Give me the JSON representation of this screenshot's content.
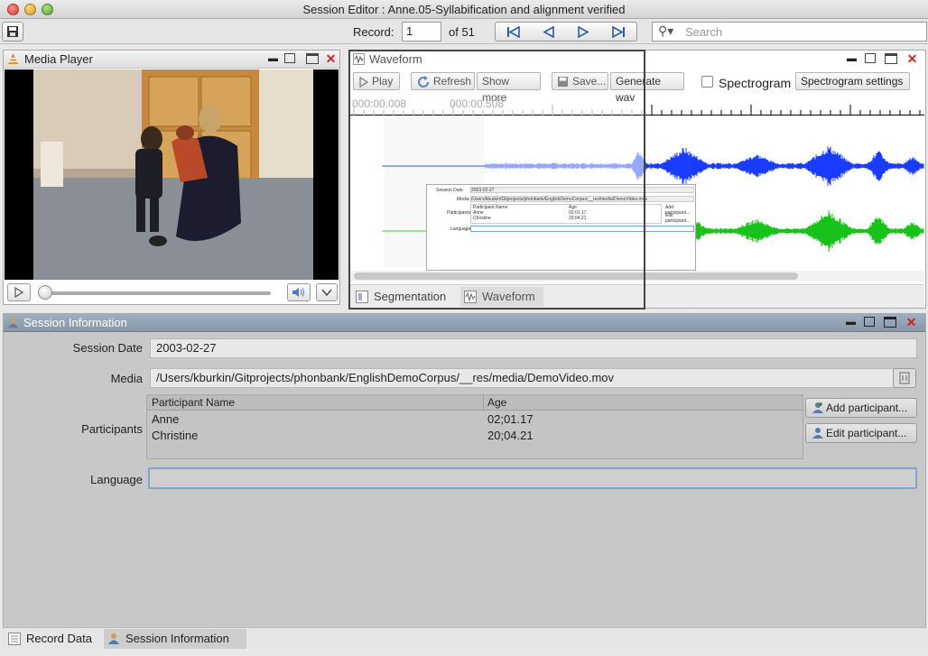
{
  "window": {
    "title": "Session Editor : Anne.05-Syllabification and alignment verified"
  },
  "toolbar": {
    "record_label": "Record:",
    "record_value": "1",
    "record_total": "of 51",
    "search_placeholder": "Search",
    "icons": [
      "save-icon",
      "first-record-icon",
      "previous-record-icon",
      "next-record-icon",
      "last-record-icon",
      "search-icon"
    ]
  },
  "media_player": {
    "title": "Media Player",
    "progress": 0.0
  },
  "waveform": {
    "title": "Waveform",
    "buttons": {
      "play": "Play",
      "refresh": "Refresh",
      "show_more": "Show more",
      "save": "Save...",
      "generate": "Generate wav",
      "spectrogram_settings": "Spectrogram settings"
    },
    "spectrogram_label": "Spectrogram",
    "spectrogram_checked": false,
    "ticks": [
      "000:00.008",
      "000:00.508"
    ],
    "tabs": [
      "Segmentation",
      "Waveform"
    ],
    "channel_colors": [
      "#1a3cff",
      "#18c21a"
    ],
    "thumbnail": {
      "session_date_label": "Session Date",
      "session_date": "2003-02-27",
      "media_label": "Media",
      "media": "/Users/kburkin/Gitprojects/phonbank/EnglishDemoCorpus/__res/media/DemoVideo.mov",
      "participants_label": "Participants",
      "headers": [
        "Participant Name",
        "Age"
      ],
      "rows": [
        [
          "Anne",
          "02;01.17"
        ],
        [
          "Christine",
          "20;04.21"
        ]
      ],
      "add": "Add participant...",
      "edit": "Edit participant...",
      "language_label": "Language"
    }
  },
  "session_info": {
    "title": "Session Information",
    "session_date_label": "Session Date",
    "session_date": "2003-02-27",
    "media_label": "Media",
    "media": "/Users/kburkin/Gitprojects/phonbank/EnglishDemoCorpus/__res/media/DemoVideo.mov",
    "participants_label": "Participants",
    "participants_headers": {
      "name": "Participant Name",
      "age": "Age"
    },
    "participants": [
      {
        "name": "Anne",
        "age": "02;01.17"
      },
      {
        "name": "Christine",
        "age": "20;04.21"
      }
    ],
    "add_participant": "Add participant...",
    "edit_participant": "Edit participant...",
    "language_label": "Language",
    "language_value": ""
  },
  "bottom_tabs": [
    "Record Data",
    "Session Information"
  ]
}
